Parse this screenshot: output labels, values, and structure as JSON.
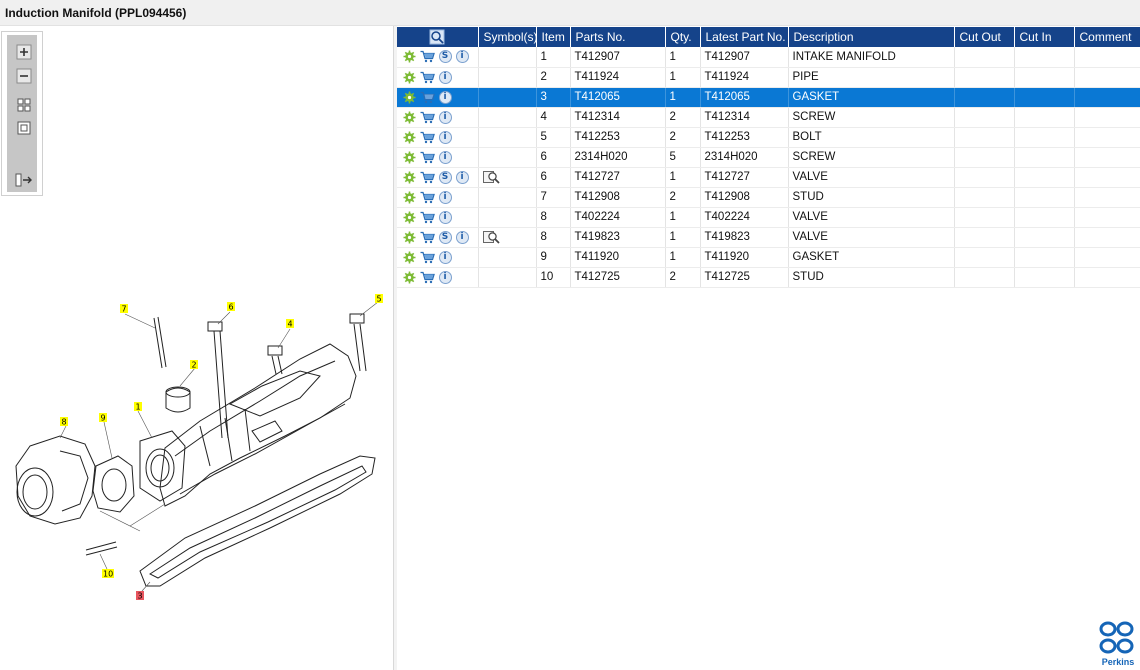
{
  "window": {
    "title": "Induction Manifold (PPL094456)"
  },
  "toolbar": {
    "buttons": [
      {
        "name": "zoom-in",
        "icon": "plus-icon"
      },
      {
        "name": "zoom-out",
        "icon": "minus-icon"
      },
      {
        "name": "fit-all",
        "icon": "grid-icon"
      },
      {
        "name": "actual-size",
        "icon": "square-icon"
      },
      {
        "name": "toggle-panel",
        "icon": "panel-arrow-icon"
      }
    ]
  },
  "diagram": {
    "callouts": [
      "1",
      "2",
      "3",
      "4",
      "5",
      "6",
      "7",
      "8",
      "9",
      "10"
    ],
    "highlighted_callout": "3",
    "callout_color": "#ffff00",
    "highlight_color": "#e8555e"
  },
  "table": {
    "headers": {
      "view": "",
      "symbols": "Symbol(s)",
      "item": "Item",
      "parts_no": "Parts No.",
      "qty": "Qty.",
      "latest": "Latest Part No.",
      "description": "Description",
      "cut_out": "Cut Out",
      "cut_in": "Cut In",
      "comment": "Comment"
    },
    "header_color": "#15438a",
    "selected_color": "#0a78d4",
    "selected_row": 2,
    "rows": [
      {
        "item": "1",
        "parts_no": "T412907",
        "qty": "1",
        "latest": "T412907",
        "description": "INTAKE MANIFOLD",
        "s_icon": true,
        "symbol": false
      },
      {
        "item": "2",
        "parts_no": "T411924",
        "qty": "1",
        "latest": "T411924",
        "description": "PIPE",
        "s_icon": false,
        "symbol": false
      },
      {
        "item": "3",
        "parts_no": "T412065",
        "qty": "1",
        "latest": "T412065",
        "description": "GASKET",
        "s_icon": false,
        "symbol": false
      },
      {
        "item": "4",
        "parts_no": "T412314",
        "qty": "2",
        "latest": "T412314",
        "description": "SCREW",
        "s_icon": false,
        "symbol": false
      },
      {
        "item": "5",
        "parts_no": "T412253",
        "qty": "2",
        "latest": "T412253",
        "description": "BOLT",
        "s_icon": false,
        "symbol": false
      },
      {
        "item": "6",
        "parts_no": "2314H020",
        "qty": "5",
        "latest": "2314H020",
        "description": "SCREW",
        "s_icon": false,
        "symbol": false
      },
      {
        "item": "6",
        "parts_no": "T412727",
        "qty": "1",
        "latest": "T412727",
        "description": "VALVE",
        "s_icon": true,
        "symbol": true
      },
      {
        "item": "7",
        "parts_no": "T412908",
        "qty": "2",
        "latest": "T412908",
        "description": "STUD",
        "s_icon": false,
        "symbol": false
      },
      {
        "item": "8",
        "parts_no": "T402224",
        "qty": "1",
        "latest": "T402224",
        "description": "VALVE",
        "s_icon": false,
        "symbol": false
      },
      {
        "item": "8",
        "parts_no": "T419823",
        "qty": "1",
        "latest": "T419823",
        "description": "VALVE",
        "s_icon": true,
        "symbol": true
      },
      {
        "item": "9",
        "parts_no": "T411920",
        "qty": "1",
        "latest": "T411920",
        "description": "GASKET",
        "s_icon": false,
        "symbol": false
      },
      {
        "item": "10",
        "parts_no": "T412725",
        "qty": "2",
        "latest": "T412725",
        "description": "STUD",
        "s_icon": false,
        "symbol": false
      }
    ]
  },
  "logo": {
    "text": "Perkins",
    "color": "#1565b7"
  }
}
